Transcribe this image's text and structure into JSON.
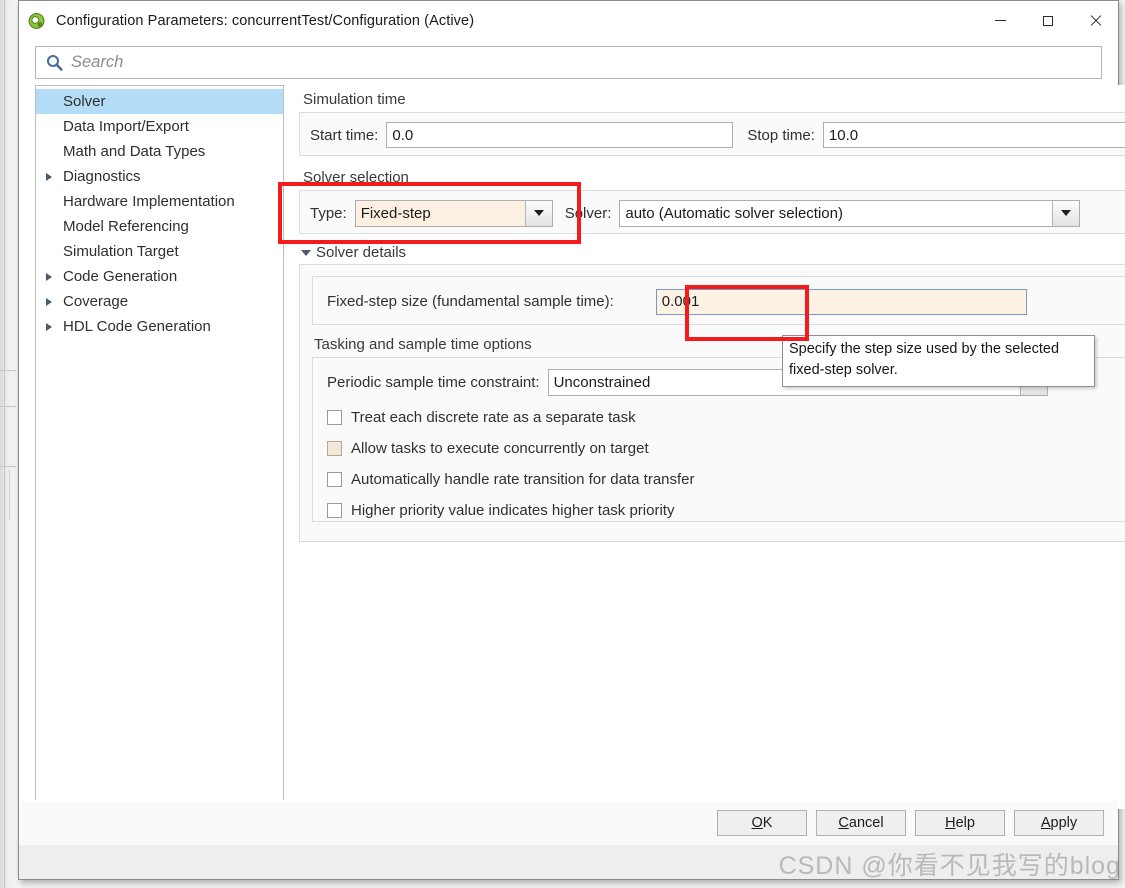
{
  "window": {
    "title": "Configuration Parameters: concurrentTest/Configuration (Active)",
    "icon": "simulink-icon",
    "minimize_label": "Minimize",
    "maximize_label": "Maximize",
    "close_label": "Close"
  },
  "search": {
    "placeholder": "Search",
    "value": "",
    "icon": "search-icon"
  },
  "sidebar": {
    "items": [
      {
        "label": "Solver",
        "expandable": false,
        "selected": true
      },
      {
        "label": "Data Import/Export",
        "expandable": false,
        "selected": false
      },
      {
        "label": "Math and Data Types",
        "expandable": false,
        "selected": false
      },
      {
        "label": "Diagnostics",
        "expandable": true,
        "selected": false
      },
      {
        "label": "Hardware Implementation",
        "expandable": false,
        "selected": false
      },
      {
        "label": "Model Referencing",
        "expandable": false,
        "selected": false
      },
      {
        "label": "Simulation Target",
        "expandable": false,
        "selected": false
      },
      {
        "label": "Code Generation",
        "expandable": true,
        "selected": false
      },
      {
        "label": "Coverage",
        "expandable": true,
        "selected": false
      },
      {
        "label": "HDL Code Generation",
        "expandable": true,
        "selected": false
      }
    ]
  },
  "main": {
    "simulation_time": {
      "group_title": "Simulation time",
      "start_label": "Start time:",
      "start_value": "0.0",
      "stop_label": "Stop time:",
      "stop_value": "10.0"
    },
    "solver_selection": {
      "group_title": "Solver selection",
      "type_label": "Type:",
      "type_value": "Fixed-step",
      "solver_label": "Solver:",
      "solver_value": "auto (Automatic solver selection)"
    },
    "solver_details": {
      "section_title": "Solver details",
      "fixed_step_label": "Fixed-step size (fundamental sample time):",
      "fixed_step_value": "0.001",
      "tooltip_text": "Specify the step size used by the selected fixed-step solver."
    },
    "tasking": {
      "group_title": "Tasking and sample time options",
      "constraint_label": "Periodic sample time constraint:",
      "constraint_value": "Unconstrained",
      "checkboxes": [
        {
          "label": "Treat each discrete rate as a separate task",
          "checked": false,
          "modified": false
        },
        {
          "label": "Allow tasks to execute concurrently on target",
          "checked": false,
          "modified": true
        },
        {
          "label": "Automatically handle rate transition for data transfer",
          "checked": false,
          "modified": false
        },
        {
          "label": "Higher priority value indicates higher task priority",
          "checked": false,
          "modified": false
        }
      ]
    }
  },
  "footer": {
    "buttons": [
      {
        "mnemonic": "O",
        "rest": "K"
      },
      {
        "mnemonic": "C",
        "rest": "ancel"
      },
      {
        "mnemonic": "H",
        "rest": "elp"
      },
      {
        "mnemonic": "A",
        "rest": "pply"
      }
    ]
  },
  "watermark": {
    "text": "CSDN @你看不见我写的blog"
  },
  "colors": {
    "selection_blue": "#b3dcf7",
    "annotation_red": "#f31b1b",
    "modified_cream": "#fbf0e2",
    "window_border": "#8a8a8a"
  }
}
